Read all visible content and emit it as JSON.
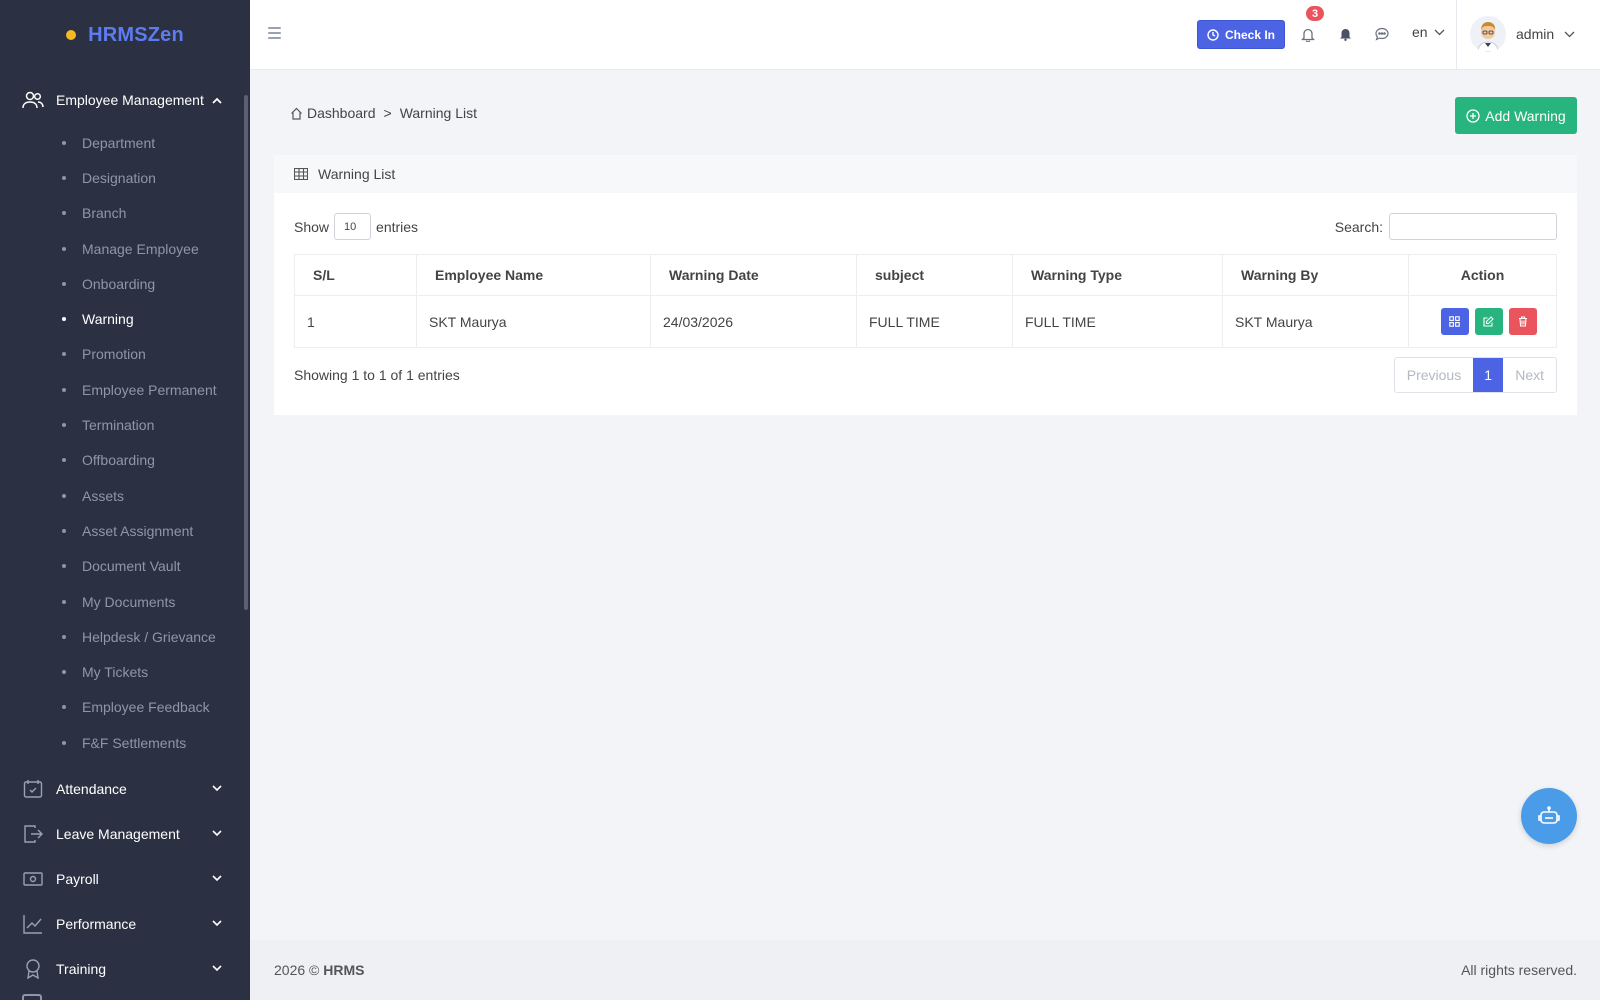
{
  "brand": {
    "name": "HRMSZen",
    "dot_color": "#f5b921"
  },
  "sidebar": {
    "open_group": {
      "label": "Employee Management",
      "icon": "users-icon"
    },
    "sub_items": [
      {
        "label": "Department",
        "active": false
      },
      {
        "label": "Designation",
        "active": false
      },
      {
        "label": "Branch",
        "active": false
      },
      {
        "label": "Manage Employee",
        "active": false
      },
      {
        "label": "Onboarding",
        "active": false
      },
      {
        "label": "Warning",
        "active": true
      },
      {
        "label": "Promotion",
        "active": false
      },
      {
        "label": "Employee Permanent",
        "active": false
      },
      {
        "label": "Termination",
        "active": false
      },
      {
        "label": "Offboarding",
        "active": false
      },
      {
        "label": "Assets",
        "active": false
      },
      {
        "label": "Asset Assignment",
        "active": false
      },
      {
        "label": "Document Vault",
        "active": false
      },
      {
        "label": "My Documents",
        "active": false
      },
      {
        "label": "Helpdesk / Grievance",
        "active": false
      },
      {
        "label": "My Tickets",
        "active": false
      },
      {
        "label": "Employee Feedback",
        "active": false
      },
      {
        "label": "F&F Settlements",
        "active": false
      }
    ],
    "groups": [
      {
        "label": "Attendance",
        "icon": "calendar-check-icon"
      },
      {
        "label": "Leave Management",
        "icon": "leave-icon"
      },
      {
        "label": "Payroll",
        "icon": "money-icon"
      },
      {
        "label": "Performance",
        "icon": "chart-line-icon"
      },
      {
        "label": "Training",
        "icon": "award-icon"
      }
    ]
  },
  "header": {
    "checkin_label": "Check In",
    "notification_count": "3",
    "language": "en",
    "username": "admin"
  },
  "breadcrumb": {
    "home": "Dashboard",
    "separator": ">",
    "current": "Warning List"
  },
  "add_button_label": "Add Warning",
  "card": {
    "title": "Warning List",
    "show_label": "Show",
    "entries_value": "10",
    "entries_label": "entries",
    "search_label": "Search:",
    "search_value": ""
  },
  "table": {
    "columns": [
      "S/L",
      "Employee Name",
      "Warning Date",
      "subject",
      "Warning Type",
      "Warning By",
      "Action"
    ],
    "rows": [
      [
        "1",
        "SKT Maurya",
        "24/03/2026",
        "FULL TIME",
        "FULL TIME",
        "SKT Maurya"
      ]
    ]
  },
  "pagination": {
    "info": "Showing 1 to 1 of 1 entries",
    "previous": "Previous",
    "current": "1",
    "next": "Next"
  },
  "footer": {
    "year_text": "2026 ©",
    "brand": "HRMS",
    "rights": "All rights reserved."
  },
  "colors": {
    "sidebar_bg": "#2b3142",
    "primary": "#4c64e4",
    "success": "#28b47e",
    "danger": "#e9545d",
    "fab": "#4a9ce8"
  }
}
